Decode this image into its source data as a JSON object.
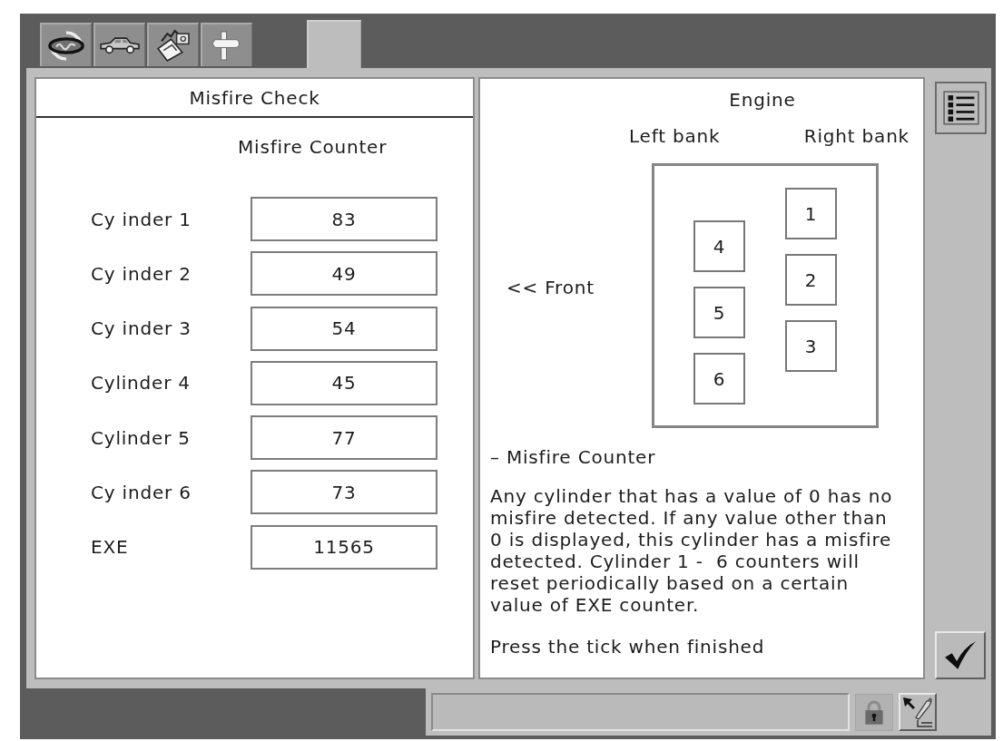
{
  "tabs": [
    {
      "selected": false
    },
    {
      "selected": false
    },
    {
      "selected": false
    },
    {
      "selected": false
    },
    {
      "selected": true
    }
  ],
  "misfire_check": {
    "title": "Misfire Check",
    "column_heading": "Misfire Counter",
    "rows": [
      {
        "label": "Cy inder 1",
        "value": "83"
      },
      {
        "label": "Cy inder 2",
        "value": "49"
      },
      {
        "label": "Cy inder 3",
        "value": "54"
      },
      {
        "label": "Cylinder 4",
        "value": "45"
      },
      {
        "label": "Cylinder 5",
        "value": "77"
      },
      {
        "label": "Cy inder 6",
        "value": "73"
      },
      {
        "label": "EXE",
        "value": "11565"
      }
    ]
  },
  "engine_info": {
    "title": "Engine",
    "front_label": "<< Front",
    "left_bank": {
      "label": "Left bank",
      "cylinders": [
        "4",
        "5",
        "6"
      ]
    },
    "right_bank": {
      "label": "Right bank",
      "cylinders": [
        "1",
        "2",
        "3"
      ]
    },
    "section_heading": "– Misfire Counter",
    "description": "Any cylinder that has a value of 0 has no misfire detected. If any value other than 0 is displayed, this cylinder has a misfire detected. Cylinder 1 -  6 counters will reset periodically based on a certain value of EXE counter.",
    "instruction": "Press the tick when finished"
  }
}
